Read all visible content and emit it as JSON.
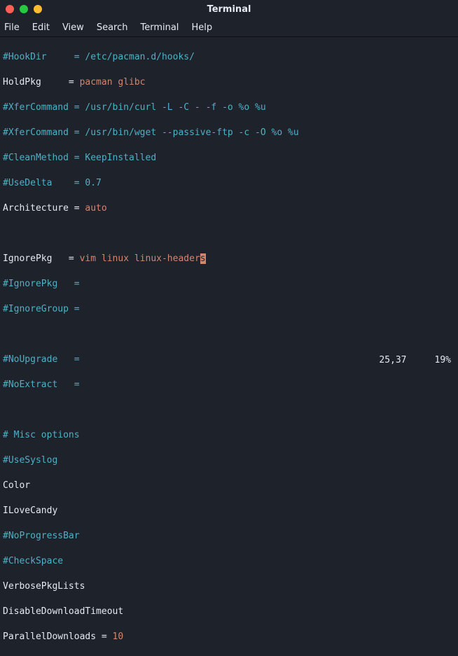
{
  "window": {
    "title": "Terminal"
  },
  "menu": {
    "file": "File",
    "edit": "Edit",
    "view": "View",
    "search": "Search",
    "terminal": "Terminal",
    "help": "Help"
  },
  "lines": {
    "l1a": "#HookDir     = /etc/pacman.d/hooks/",
    "l2a": "HoldPkg     = ",
    "l2b": "pacman glibc",
    "l3a": "#XferCommand = /usr/bin/curl -L -C - -f -o %o %u",
    "l4a": "#XferCommand = /usr/bin/wget --passive-ftp -c -O %o %u",
    "l5a": "#CleanMethod = KeepInstalled",
    "l6a": "#UseDelta    = 0.7",
    "l7a": "Architecture = ",
    "l7b": "auto",
    "l8a": "",
    "l9a": "IgnorePkg   = ",
    "l9b": "vim linux linux-header",
    "l9c": "s",
    "l10a": "#IgnorePkg   =",
    "l11a": "#IgnoreGroup =",
    "l12a": "",
    "l13a": "#NoUpgrade   =",
    "l14a": "#NoExtract   =",
    "l15a": "",
    "l16a": "# Misc options",
    "l17a": "#UseSyslog",
    "l18a": "Color",
    "l19a": "ILoveCandy",
    "l20a": "#NoProgressBar",
    "l21a": "#CheckSpace",
    "l22a": "VerbosePkgLists",
    "l23a": "DisableDownloadTimeout",
    "l24a": "ParallelDownloads = ",
    "l24b": "10"
  },
  "status": {
    "position": "25,37",
    "percent": "19%"
  }
}
